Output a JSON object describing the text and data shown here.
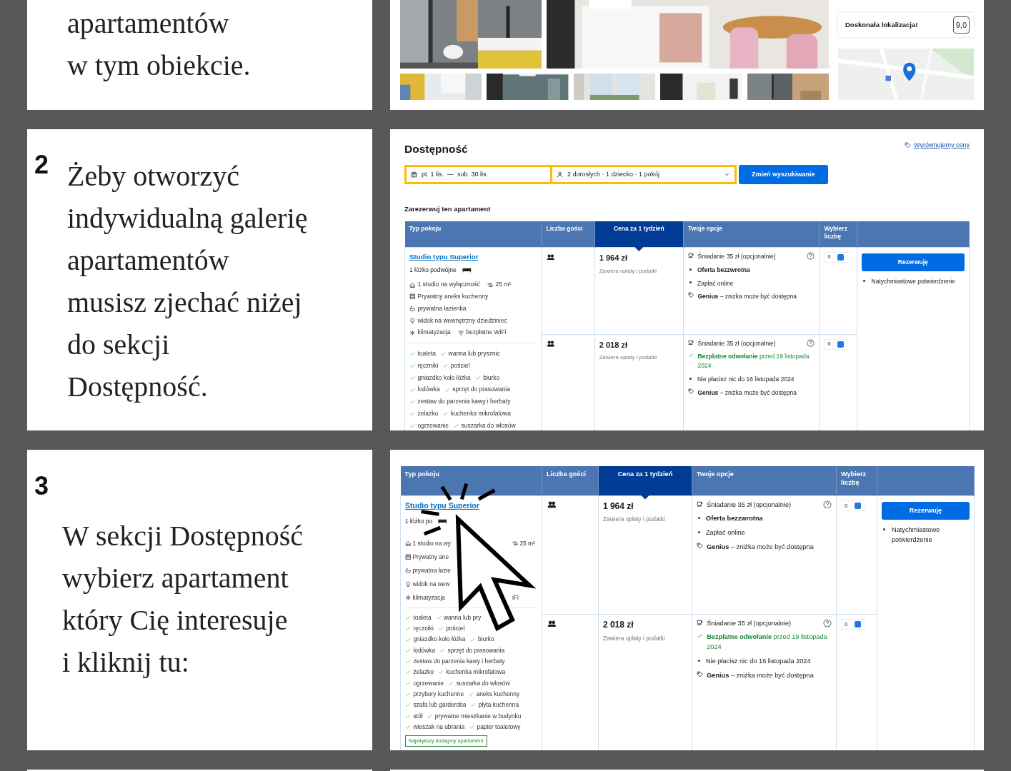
{
  "steps": [
    {
      "kind": "stacked",
      "text": "apartamentów\nw tym obiekcie.",
      "panel": {
        "kind": "gallery",
        "rating_label": "Doskonała lokalizacja!",
        "rating": "9,0"
      }
    },
    {
      "kind": "side",
      "number": "2",
      "text": "Żeby otworzyć\nindywidualną galerię\napartamentów\nmusisz zjechać niżej\ndo sekcji\nDostępność.",
      "panel": {
        "kind": "availability",
        "heading": "Dostępność",
        "price_match": "Wyrównujemy ceny",
        "dates": "pt. 1 lis.  —  sob. 30 lis.",
        "guests": "2 dorosłych · 1 dziecko · 1 pokój",
        "search_button": "Zmień wyszukiwanie",
        "table_title": "Zarezerwuj ten apartament",
        "table": {
          "columns": [
            {
              "label": "Typ pokoju",
              "selected": false
            },
            {
              "label": "Liczba gości",
              "selected": false
            },
            {
              "label": "Cena za 1 tydzień",
              "selected": true
            },
            {
              "label": "Twoje opcje",
              "selected": false
            },
            {
              "label": "Wybierz liczbę",
              "selected": false
            }
          ],
          "room": {
            "name": "Studio typu Superior",
            "bed": "1 łóżko podwójne",
            "features": [
              [
                {
                  "kind": "home",
                  "text": "1 studio na wyłączność"
                },
                {
                  "kind": "area",
                  "text": "25 m²"
                }
              ],
              [
                {
                  "kind": "kitchen",
                  "text": "Prywatny aneks kuchenny"
                }
              ],
              [
                {
                  "kind": "bath",
                  "text": "prywatna łazienka"
                }
              ],
              [
                {
                  "kind": "view",
                  "text": "widok na wewnętrzny dziedziniec"
                }
              ],
              [
                {
                  "kind": "ac",
                  "text": "klimatyzacja"
                },
                {
                  "kind": "wifi",
                  "text": "bezpłatne WiFi"
                }
              ]
            ],
            "amenities": [
              [
                "toaleta",
                "wanna lub prysznic"
              ],
              [
                "ręczniki",
                "pościel"
              ],
              [
                "gniazdko koło łóżka",
                "biurko"
              ],
              [
                "lodówka",
                "sprzęt do prasowania"
              ],
              [
                "zestaw do parzenia kawy i herbaty"
              ],
              [
                "żelazko",
                "kuchenka mikrofalowa"
              ],
              [
                "ogrzewanie",
                "suszarka do włosów"
              ]
            ]
          },
          "rows": [
            {
              "price": "1 964 zł",
              "price_note": "Zawiera opłaty i podatki",
              "quantity": "0",
              "options": [
                {
                  "kind": "meal",
                  "text": "Śniadanie 35 zł (opcjonalnie)"
                },
                {
                  "kind": "bold-bullet",
                  "text": "Oferta bezzwrotna"
                },
                {
                  "kind": "bullet",
                  "text": "Zapłać online"
                },
                {
                  "kind": "genius",
                  "text": "**Genius** – zniżka może być dostępna"
                }
              ]
            },
            {
              "price": "2 018 zł",
              "price_note": "Zawiera opłaty i podatki",
              "quantity": "0",
              "options": [
                {
                  "kind": "meal",
                  "text": "Śniadanie 35 zł (opcjonalnie)"
                },
                {
                  "kind": "check",
                  "text": "**Bezpłatne odwołanie** przed 19 listopada 2024"
                },
                {
                  "kind": "bullet",
                  "text": "Nie płacisz nic do 16 listopada 2024"
                },
                {
                  "kind": "genius",
                  "text": "**Genius** – zniżka może być dostępna"
                }
              ]
            }
          ],
          "reserve_button": "Rezerwuję",
          "reserve_note": "Natychmiastowe potwierdzenie"
        }
      }
    },
    {
      "kind": "stacked",
      "number": "3",
      "text": "W sekcji Dostępność\nwybierz apartament\nktóry Cię interesuje\ni kliknij tu:",
      "panel": {
        "kind": "table",
        "table": {
          "columns": [
            {
              "label": "Typ pokoju",
              "selected": false
            },
            {
              "label": "Liczba gości",
              "selected": false
            },
            {
              "label": "Cena za 1 tydzień",
              "selected": true
            },
            {
              "label": "Twoje opcje",
              "selected": false
            },
            {
              "label": "Wybierz liczbę",
              "selected": false
            }
          ],
          "room": {
            "name": "Studio typu Superior",
            "bed": "1 łóżko po",
            "features": [
              [
                {
                  "kind": "home",
                  "text": "1 studio na wy"
                },
                {
                  "kind": "area",
                  "text": "25 m²"
                }
              ],
              [
                {
                  "kind": "kitchen",
                  "text": "Prywatny ane"
                }
              ],
              [
                {
                  "kind": "bath",
                  "text": "prywatna łazie"
                }
              ],
              [
                {
                  "kind": "view",
                  "text": "widok na wew"
                }
              ],
              [
                {
                  "kind": "ac",
                  "text": "klimatyzacja"
                },
                {
                  "kind": "plain",
                  "text": "iFi"
                }
              ]
            ],
            "amenities": [
              [
                "toaleta",
                "wanna lub pry"
              ],
              [
                "ręczniki",
                "pościel"
              ],
              [
                "gniazdko koło łóżka",
                "biurko"
              ],
              [
                "lodówka",
                "sprzęt do prasowania"
              ],
              [
                "zestaw do parzenia kawy i herbaty"
              ],
              [
                "żelazko",
                "kuchenka mikrofalowa"
              ],
              [
                "ogrzewanie",
                "suszarka do włosów"
              ],
              [
                "przybory kuchenne",
                "aneks kuchenny"
              ],
              [
                "szafa lub garderoba",
                "płyta kuchenna"
              ],
              [
                "stół",
                "prywatne mieszkanie w budynku"
              ],
              [
                "wieszak na ubrania",
                "papier toaletowy"
              ]
            ],
            "badge": "Największy dostępny apartament"
          },
          "rows": [
            {
              "price": "1 964 zł",
              "price_note": "Zawiera opłaty i podatki",
              "quantity": "0",
              "options": [
                {
                  "kind": "meal",
                  "text": "Śniadanie 35 zł (opcjonalnie)"
                },
                {
                  "kind": "bold-bullet",
                  "text": "Oferta bezzwrotna"
                },
                {
                  "kind": "bullet",
                  "text": "Zapłać online"
                },
                {
                  "kind": "genius",
                  "text": "**Genius** – zniżka może być dostępna"
                }
              ]
            },
            {
              "price": "2 018 zł",
              "price_note": "Zawiera opłaty i podatki",
              "quantity": "0",
              "options": [
                {
                  "kind": "meal",
                  "text": "Śniadanie 35 zł (opcjonalnie)"
                },
                {
                  "kind": "check",
                  "text": "**Bezpłatne odwołanie** przed 19 listopada 2024"
                },
                {
                  "kind": "bullet",
                  "text": "Nie płacisz nic do 16 listopada 2024"
                },
                {
                  "kind": "genius",
                  "text": "**Genius** – zniżka może być dostępna"
                }
              ]
            }
          ],
          "reserve_button": "Rezerwuję",
          "reserve_note": "Natychmiastowe potwierdzenie"
        }
      }
    }
  ]
}
